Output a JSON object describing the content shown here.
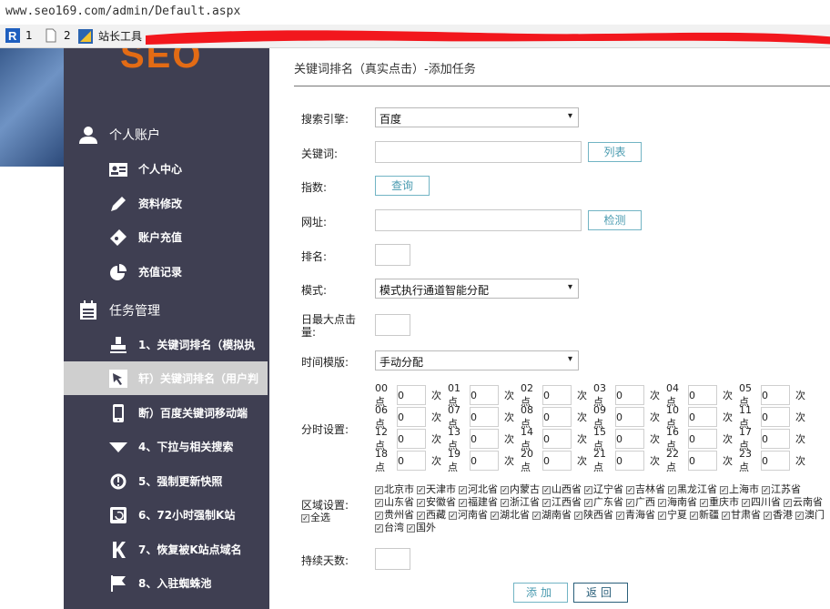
{
  "browser": {
    "url": "www.seo169.com/admin/Default.aspx",
    "bookmarks": [
      {
        "icon": "r-logo-icon",
        "label": "1"
      },
      {
        "icon": "page-icon",
        "label": "2"
      },
      {
        "icon": "tools-icon",
        "label": "站长工具"
      }
    ]
  },
  "sidebar": {
    "logo": "SEO",
    "groups": [
      {
        "label": "个人账户",
        "icon": "user-icon",
        "items": [
          {
            "label": "个人中心",
            "icon": "id-card-icon"
          },
          {
            "label": "资料修改",
            "icon": "pencil-icon"
          },
          {
            "label": "账户充值",
            "icon": "ticket-icon"
          },
          {
            "label": "充值记录",
            "icon": "pie-chart-icon"
          }
        ]
      },
      {
        "label": "任务管理",
        "icon": "clipboard-icon",
        "items": [
          {
            "label": "1、关键词排名（模拟执",
            "icon": "stamp-icon"
          },
          {
            "label": "轩）关键词排名（用户判",
            "icon": "cursor-icon",
            "active": true
          },
          {
            "label": "断）百度关键词移动端",
            "icon": "phone-icon"
          },
          {
            "label": "4、下拉与相关搜索",
            "icon": "caret-down-icon"
          },
          {
            "label": "5、强制更新快照",
            "icon": "refresh-icon"
          },
          {
            "label": "6、72小时强制K站",
            "icon": "tablet-icon"
          },
          {
            "label": "7、恢复被K站点域名",
            "icon": "k-icon"
          },
          {
            "label": "8、入驻蜘蛛池",
            "icon": "flag-icon"
          }
        ]
      }
    ]
  },
  "main": {
    "breadcrumb": "关键词排名（真实点击）-添加任务",
    "form": {
      "engine": {
        "label": "搜索引擎:",
        "value": "百度"
      },
      "keyword": {
        "label": "关键词:",
        "value": "",
        "button": "列表"
      },
      "index": {
        "label": "指数:",
        "button": "查询"
      },
      "url": {
        "label": "网址:",
        "value": "",
        "button": "检测"
      },
      "rank": {
        "label": "排名:",
        "value": ""
      },
      "mode": {
        "label": "模式:",
        "value": "模式执行通道智能分配"
      },
      "daily_max": {
        "label": "日最大点击量:",
        "value": ""
      },
      "time_mode": {
        "label": "时间模版:",
        "value": "手动分配"
      },
      "hourly": {
        "label": "分时设置:",
        "unit": "次",
        "hours": [
          {
            "h": "00点",
            "v": "0"
          },
          {
            "h": "01点",
            "v": "0"
          },
          {
            "h": "02点",
            "v": "0"
          },
          {
            "h": "03点",
            "v": "0"
          },
          {
            "h": "04点",
            "v": "0"
          },
          {
            "h": "05点",
            "v": "0"
          },
          {
            "h": "06点",
            "v": "0"
          },
          {
            "h": "07点",
            "v": "0"
          },
          {
            "h": "08点",
            "v": "0"
          },
          {
            "h": "09点",
            "v": "0"
          },
          {
            "h": "10点",
            "v": "0"
          },
          {
            "h": "11点",
            "v": "0"
          },
          {
            "h": "12点",
            "v": "0"
          },
          {
            "h": "13点",
            "v": "0"
          },
          {
            "h": "14点",
            "v": "0"
          },
          {
            "h": "15点",
            "v": "0"
          },
          {
            "h": "16点",
            "v": "0"
          },
          {
            "h": "17点",
            "v": "0"
          },
          {
            "h": "18点",
            "v": "0"
          },
          {
            "h": "19点",
            "v": "0"
          },
          {
            "h": "20点",
            "v": "0"
          },
          {
            "h": "21点",
            "v": "0"
          },
          {
            "h": "22点",
            "v": "0"
          },
          {
            "h": "23点",
            "v": "0"
          }
        ]
      },
      "regions": {
        "label": "区域设置:",
        "select_all": "全选",
        "items": [
          "北京市",
          "天津市",
          "河北省",
          "内蒙古",
          "山西省",
          "辽宁省",
          "吉林省",
          "黑龙江省",
          "上海市",
          "江苏省",
          "山东省",
          "安徽省",
          "福建省",
          "浙江省",
          "江西省",
          "广东省",
          "广西",
          "海南省",
          "重庆市",
          "四川省",
          "云南省",
          "贵州省",
          "西藏",
          "河南省",
          "湖北省",
          "湖南省",
          "陕西省",
          "青海省",
          "宁夏",
          "新疆",
          "甘肃省",
          "香港",
          "澳门",
          "台湾",
          "国外"
        ]
      },
      "days": {
        "label": "持续天数:",
        "value": ""
      },
      "submit": "添加",
      "back": "返回"
    }
  },
  "colors": {
    "sidebar_bg": "#3f3f52",
    "accent": "#4a9bb0",
    "logo": "#e36b14"
  }
}
